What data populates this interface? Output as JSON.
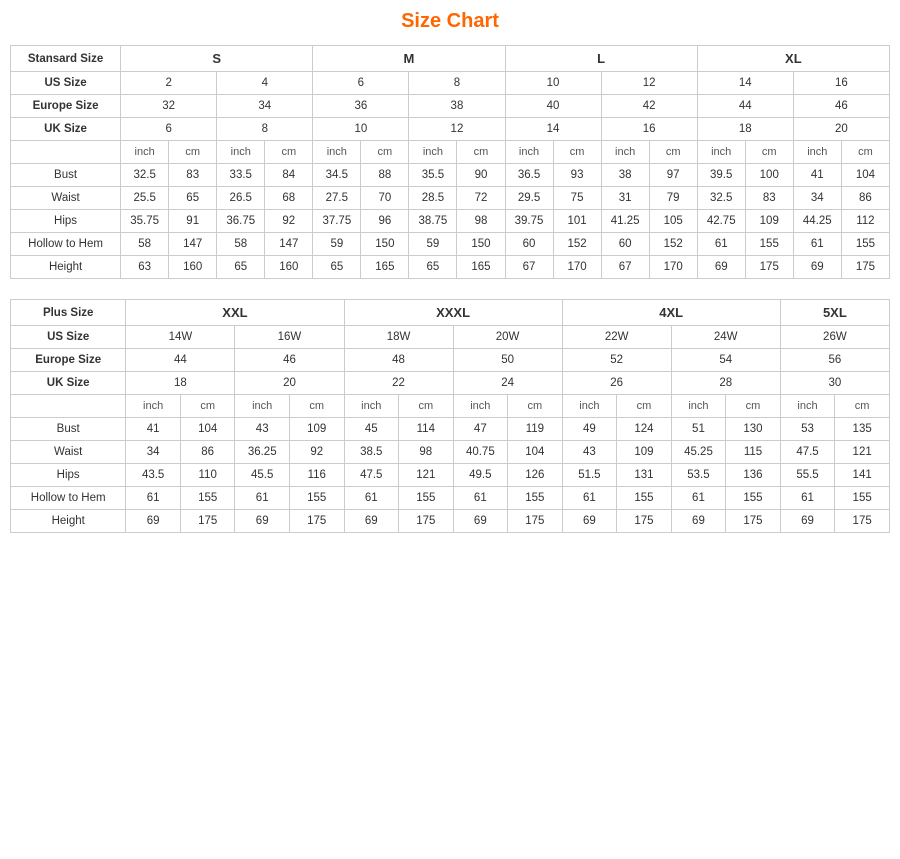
{
  "title": "Size Chart",
  "standard": {
    "label": "Stansard Size",
    "sizeGroups": [
      "S",
      "M",
      "L",
      "XL"
    ],
    "usSizes": [
      "2",
      "4",
      "6",
      "8",
      "10",
      "12",
      "14",
      "16"
    ],
    "europeSizes": [
      "32",
      "34",
      "36",
      "38",
      "40",
      "42",
      "44",
      "46"
    ],
    "ukSizes": [
      "6",
      "8",
      "10",
      "12",
      "14",
      "16",
      "18",
      "20"
    ],
    "unitRow": [
      "inch",
      "cm",
      "inch",
      "cm",
      "inch",
      "cm",
      "inch",
      "cm",
      "inch",
      "cm",
      "inch",
      "cm",
      "inch",
      "cm",
      "inch",
      "cm"
    ],
    "measurements": [
      {
        "label": "Bust",
        "values": [
          "32.5",
          "83",
          "33.5",
          "84",
          "34.5",
          "88",
          "35.5",
          "90",
          "36.5",
          "93",
          "38",
          "97",
          "39.5",
          "100",
          "41",
          "104"
        ]
      },
      {
        "label": "Waist",
        "values": [
          "25.5",
          "65",
          "26.5",
          "68",
          "27.5",
          "70",
          "28.5",
          "72",
          "29.5",
          "75",
          "31",
          "79",
          "32.5",
          "83",
          "34",
          "86"
        ]
      },
      {
        "label": "Hips",
        "values": [
          "35.75",
          "91",
          "36.75",
          "92",
          "37.75",
          "96",
          "38.75",
          "98",
          "39.75",
          "101",
          "41.25",
          "105",
          "42.75",
          "109",
          "44.25",
          "112"
        ]
      },
      {
        "label": "Hollow to Hem",
        "values": [
          "58",
          "147",
          "58",
          "147",
          "59",
          "150",
          "59",
          "150",
          "60",
          "152",
          "60",
          "152",
          "61",
          "155",
          "61",
          "155"
        ]
      },
      {
        "label": "Height",
        "values": [
          "63",
          "160",
          "65",
          "160",
          "65",
          "165",
          "65",
          "165",
          "67",
          "170",
          "67",
          "170",
          "69",
          "175",
          "69",
          "175"
        ]
      }
    ]
  },
  "plus": {
    "label": "Plus Size",
    "sizeGroups": [
      "XXL",
      "XXXL",
      "4XL",
      "5XL"
    ],
    "usSizes": [
      "14W",
      "16W",
      "18W",
      "20W",
      "22W",
      "24W",
      "26W"
    ],
    "europeSizes": [
      "44",
      "46",
      "48",
      "50",
      "52",
      "54",
      "56"
    ],
    "ukSizes": [
      "18",
      "20",
      "22",
      "24",
      "26",
      "28",
      "30"
    ],
    "unitRow": [
      "inch",
      "cm",
      "inch",
      "cm",
      "inch",
      "cm",
      "inch",
      "cm",
      "inch",
      "cm",
      "inch",
      "cm",
      "inch",
      "cm"
    ],
    "measurements": [
      {
        "label": "Bust",
        "values": [
          "41",
          "104",
          "43",
          "109",
          "45",
          "114",
          "47",
          "119",
          "49",
          "124",
          "51",
          "130",
          "53",
          "135"
        ]
      },
      {
        "label": "Waist",
        "values": [
          "34",
          "86",
          "36.25",
          "92",
          "38.5",
          "98",
          "40.75",
          "104",
          "43",
          "109",
          "45.25",
          "115",
          "47.5",
          "121"
        ]
      },
      {
        "label": "Hips",
        "values": [
          "43.5",
          "110",
          "45.5",
          "116",
          "47.5",
          "121",
          "49.5",
          "126",
          "51.5",
          "131",
          "53.5",
          "136",
          "55.5",
          "141"
        ]
      },
      {
        "label": "Hollow to Hem",
        "values": [
          "61",
          "155",
          "61",
          "155",
          "61",
          "155",
          "61",
          "155",
          "61",
          "155",
          "61",
          "155",
          "61",
          "155"
        ]
      },
      {
        "label": "Height",
        "values": [
          "69",
          "175",
          "69",
          "175",
          "69",
          "175",
          "69",
          "175",
          "69",
          "175",
          "69",
          "175",
          "69",
          "175"
        ]
      }
    ]
  }
}
